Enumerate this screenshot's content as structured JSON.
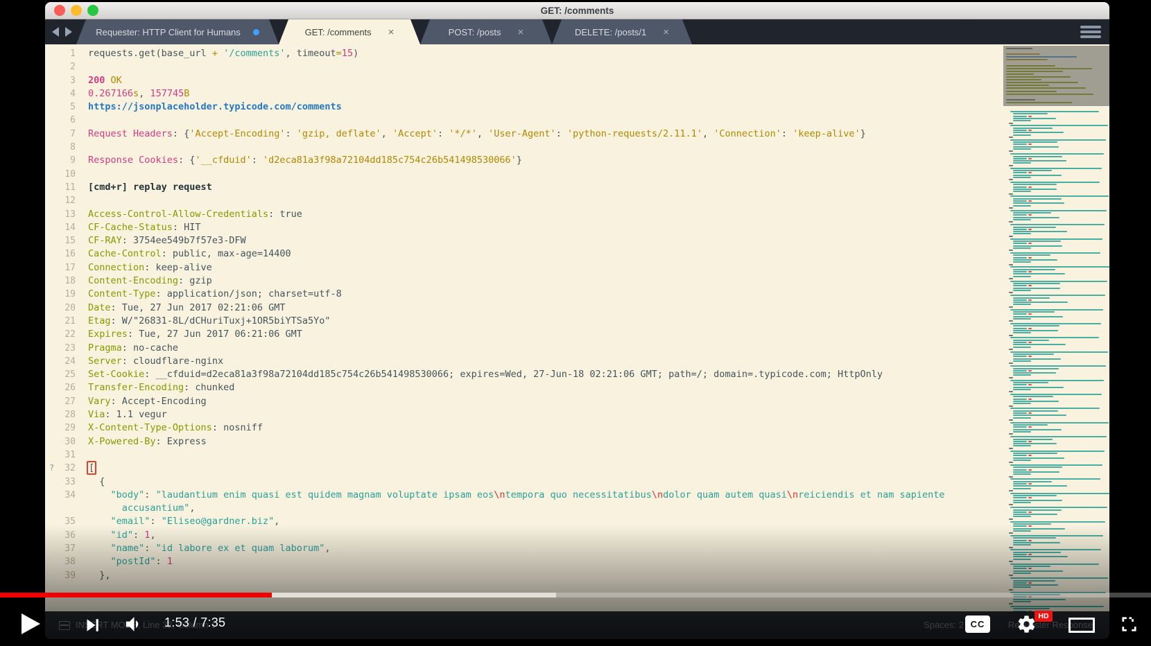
{
  "window": {
    "title": "GET: /comments"
  },
  "tabs": [
    {
      "label": "Requester: HTTP Client for Humans",
      "active": false,
      "modified_dot": true,
      "closable": false
    },
    {
      "label": "GET: /comments",
      "active": true,
      "modified_dot": false,
      "closable": true
    },
    {
      "label": "POST: /posts",
      "active": false,
      "modified_dot": false,
      "closable": true
    },
    {
      "label": "DELETE: /posts/1",
      "active": false,
      "modified_dot": false,
      "closable": true
    }
  ],
  "tab_close_glyph": "×",
  "editor": {
    "rows": [
      {
        "n": "1",
        "s": [
          [
            "requests.get(base_url ",
            "d"
          ],
          [
            "+",
            "o"
          ],
          [
            " ",
            "d"
          ],
          [
            "'/comments'",
            "t"
          ],
          [
            ", timeout",
            "d"
          ],
          [
            "=",
            "o"
          ],
          [
            "15",
            "m"
          ],
          [
            ")",
            "d"
          ]
        ]
      },
      {
        "n": "2",
        "s": []
      },
      {
        "n": "3",
        "s": [
          [
            "200",
            "m bold"
          ],
          [
            " OK",
            "o"
          ]
        ]
      },
      {
        "n": "4",
        "s": [
          [
            "0.267166",
            "m"
          ],
          [
            "s",
            "o"
          ],
          [
            ", ",
            "d"
          ],
          [
            "157745",
            "m"
          ],
          [
            "B",
            "o"
          ]
        ]
      },
      {
        "n": "5",
        "s": [
          [
            "https://jsonplaceholder.typicode.com/comments",
            "b bold"
          ]
        ]
      },
      {
        "n": "6",
        "s": []
      },
      {
        "n": "7",
        "s": [
          [
            "Request Headers",
            "m"
          ],
          [
            ": {",
            "d"
          ],
          [
            "'Accept-Encoding'",
            "o"
          ],
          [
            ": ",
            "d"
          ],
          [
            "'gzip, deflate'",
            "o"
          ],
          [
            ", ",
            "d"
          ],
          [
            "'Accept'",
            "o"
          ],
          [
            ": ",
            "d"
          ],
          [
            "'*/*'",
            "o"
          ],
          [
            ", ",
            "d"
          ],
          [
            "'User-Agent'",
            "o"
          ],
          [
            ": ",
            "d"
          ],
          [
            "'python-requests/2.11.1'",
            "o"
          ],
          [
            ", ",
            "d"
          ],
          [
            "'Connection'",
            "o"
          ],
          [
            ": ",
            "d"
          ],
          [
            "'keep-alive'",
            "o"
          ],
          [
            "}",
            "d"
          ]
        ]
      },
      {
        "n": "8",
        "s": []
      },
      {
        "n": "9",
        "s": [
          [
            "Response Cookies",
            "m"
          ],
          [
            ": {",
            "d"
          ],
          [
            "'__cfduid'",
            "o"
          ],
          [
            ": ",
            "d"
          ],
          [
            "'d2eca81a3f98a72104dd185c754c26b541498530066'",
            "o"
          ],
          [
            "}",
            "d"
          ]
        ]
      },
      {
        "n": "10",
        "s": []
      },
      {
        "n": "11",
        "s": [
          [
            "[cmd+r] replay request",
            "k bold"
          ]
        ]
      },
      {
        "n": "12",
        "s": []
      },
      {
        "n": "13",
        "s": [
          [
            "Access-Control-Allow-Credentials",
            "g"
          ],
          [
            ": true",
            "d"
          ]
        ]
      },
      {
        "n": "14",
        "s": [
          [
            "CF-Cache-Status",
            "g"
          ],
          [
            ": HIT",
            "d"
          ]
        ]
      },
      {
        "n": "15",
        "s": [
          [
            "CF-RAY",
            "g"
          ],
          [
            ": 3754ee549b7f57e3-DFW",
            "d"
          ]
        ]
      },
      {
        "n": "16",
        "s": [
          [
            "Cache-Control",
            "g"
          ],
          [
            ": public, max-age=14400",
            "d"
          ]
        ]
      },
      {
        "n": "17",
        "s": [
          [
            "Connection",
            "g"
          ],
          [
            ": keep-alive",
            "d"
          ]
        ]
      },
      {
        "n": "18",
        "s": [
          [
            "Content-Encoding",
            "g"
          ],
          [
            ": gzip",
            "d"
          ]
        ]
      },
      {
        "n": "19",
        "s": [
          [
            "Content-Type",
            "g"
          ],
          [
            ": application/json; charset=utf-8",
            "d"
          ]
        ]
      },
      {
        "n": "20",
        "s": [
          [
            "Date",
            "g"
          ],
          [
            ": Tue, 27 Jun 2017 02:21:06 GMT",
            "d"
          ]
        ]
      },
      {
        "n": "21",
        "s": [
          [
            "Etag",
            "g"
          ],
          [
            ": W/\"26831-8L/dCHuriTuxj+1OR5biYTSa5Yo\"",
            "d"
          ]
        ]
      },
      {
        "n": "22",
        "s": [
          [
            "Expires",
            "g"
          ],
          [
            ": Tue, 27 Jun 2017 06:21:06 GMT",
            "d"
          ]
        ]
      },
      {
        "n": "23",
        "s": [
          [
            "Pragma",
            "g"
          ],
          [
            ": no-cache",
            "d"
          ]
        ]
      },
      {
        "n": "24",
        "s": [
          [
            "Server",
            "g"
          ],
          [
            ": cloudflare-nginx",
            "d"
          ]
        ]
      },
      {
        "n": "25",
        "s": [
          [
            "Set-Cookie",
            "g"
          ],
          [
            ": __cfduid=d2eca81a3f98a72104dd185c754c26b541498530066; expires=Wed, 27-Jun-18 02:21:06 GMT; path=/; domain=.typicode.com; HttpOnly",
            "d"
          ]
        ]
      },
      {
        "n": "26",
        "s": [
          [
            "Transfer-Encoding",
            "g"
          ],
          [
            ": chunked",
            "d"
          ]
        ]
      },
      {
        "n": "27",
        "s": [
          [
            "Vary",
            "g"
          ],
          [
            ": Accept-Encoding",
            "d"
          ]
        ]
      },
      {
        "n": "28",
        "s": [
          [
            "Via",
            "g"
          ],
          [
            ": 1.1 vegur",
            "d"
          ]
        ]
      },
      {
        "n": "29",
        "s": [
          [
            "X-Content-Type-Options",
            "g"
          ],
          [
            ": nosniff",
            "d"
          ]
        ]
      },
      {
        "n": "30",
        "s": [
          [
            "X-Powered-By",
            "g"
          ],
          [
            ": Express",
            "d"
          ]
        ]
      },
      {
        "n": "31",
        "s": []
      },
      {
        "n": "32",
        "marker": "?",
        "s": [
          [
            "[",
            "d cursor"
          ]
        ]
      },
      {
        "n": "33",
        "s": [
          [
            "  {",
            "d"
          ]
        ]
      },
      {
        "n": "34",
        "s": [
          [
            "    ",
            "d"
          ],
          [
            "\"body\"",
            "t"
          ],
          [
            ": ",
            "d"
          ],
          [
            "\"laudantium enim quasi est quidem magnam voluptate ipsam eos",
            "t"
          ],
          [
            "\\n",
            "r"
          ],
          [
            "tempora quo necessitatibus",
            "t"
          ],
          [
            "\\n",
            "r"
          ],
          [
            "dolor quam autem quasi",
            "t"
          ],
          [
            "\\n",
            "r"
          ],
          [
            "reiciendis et nam sapiente",
            "t"
          ]
        ]
      },
      {
        "n": "",
        "s": [
          [
            "      accusantium\"",
            "t"
          ],
          [
            ",",
            "d"
          ]
        ]
      },
      {
        "n": "35",
        "s": [
          [
            "    ",
            "d"
          ],
          [
            "\"email\"",
            "t"
          ],
          [
            ": ",
            "d"
          ],
          [
            "\"Eliseo@gardner.biz\"",
            "t"
          ],
          [
            ",",
            "d"
          ]
        ]
      },
      {
        "n": "36",
        "s": [
          [
            "    ",
            "d"
          ],
          [
            "\"id\"",
            "t"
          ],
          [
            ": ",
            "d"
          ],
          [
            "1",
            "m"
          ],
          [
            ",",
            "d"
          ]
        ]
      },
      {
        "n": "37",
        "s": [
          [
            "    ",
            "d"
          ],
          [
            "\"name\"",
            "t"
          ],
          [
            ": ",
            "d"
          ],
          [
            "\"id labore ex et quam laborum\"",
            "t"
          ],
          [
            ",",
            "d"
          ]
        ]
      },
      {
        "n": "38",
        "s": [
          [
            "    ",
            "d"
          ],
          [
            "\"postId\"",
            "t"
          ],
          [
            ": ",
            "d"
          ],
          [
            "1",
            "m"
          ]
        ]
      },
      {
        "n": "39",
        "s": [
          [
            "  },",
            "d"
          ]
        ]
      }
    ],
    "status_left": "INSERT MODE, Line 32, Column 1",
    "status_spaces": "Spaces: 2",
    "status_right": "Requester Response"
  },
  "minimap": {
    "palette": {
      "t": "#2aa198",
      "d": "#55636b",
      "o": "#b58900",
      "m": "#d33682",
      "b": "#268bd2",
      "g": "#859900",
      "r": "#dc322f"
    }
  },
  "player": {
    "time": "1:53 / 7:35",
    "played_fraction": 0.236,
    "buffered_fraction": 0.483,
    "cc_label": "CC",
    "hd_label": "HD",
    "progress_color": "#f20000"
  },
  "theme": {
    "editor_bg": "#f8f2df",
    "tabbar_bg": "#20242c",
    "inactive_tab_bg": "#4e5869",
    "statusbar_bg": "#262a31",
    "traffic_red": "#f95f57",
    "traffic_yellow": "#fdbc2e",
    "traffic_green": "#29c740"
  }
}
